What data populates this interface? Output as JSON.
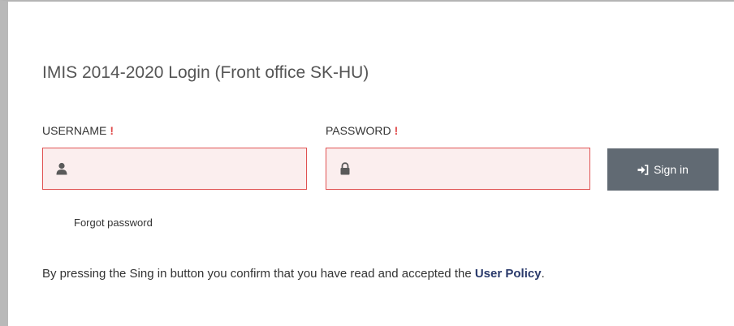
{
  "page": {
    "title": "IMIS 2014-2020 Login (Front office SK-HU)"
  },
  "form": {
    "username_label": "USERNAME",
    "password_label": "PASSWORD",
    "required_marker": "!",
    "username_value": "",
    "password_value": "",
    "username_icon": "user-icon",
    "password_icon": "lock-icon",
    "signin_icon": "sign-in-icon",
    "signin_label": "Sign in",
    "forgot_label": "Forgot password"
  },
  "notice": {
    "text": "By pressing the Sing in button you confirm that you have read and accepted the ",
    "link_label": "User Policy",
    "end": "."
  },
  "colors": {
    "required": "#e04b4b",
    "field_border": "#e05252",
    "field_bg": "#fbeeee",
    "button_bg": "#616a73",
    "link": "#2a3a6b"
  }
}
